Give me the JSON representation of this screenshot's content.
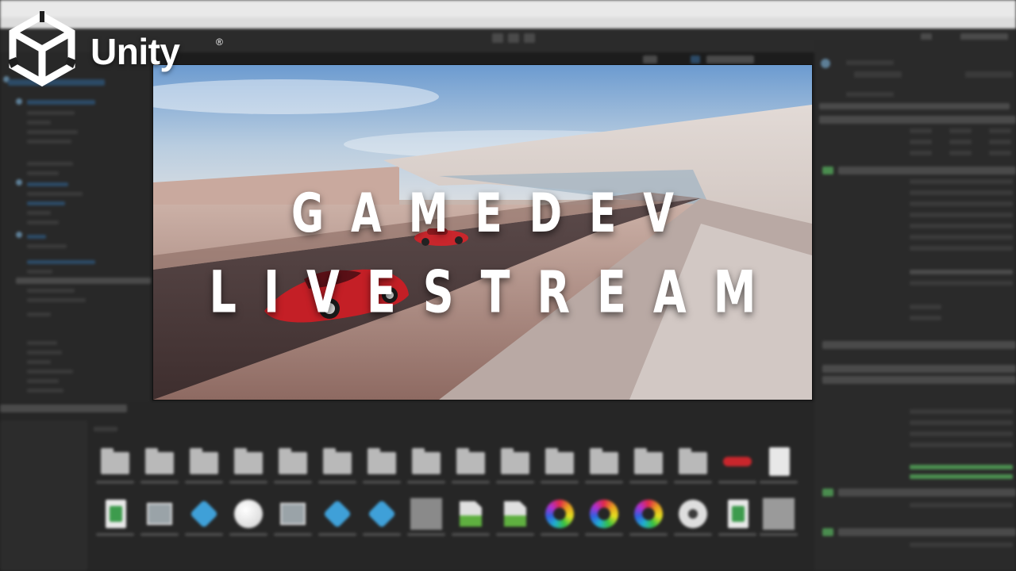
{
  "logo": {
    "wordmark": "Unity",
    "registered": "®"
  },
  "headline": {
    "line1": "GAMEDEV",
    "line2": "LIVESTREAM"
  },
  "colors": {
    "editor_bg": "#1f1f1f",
    "panel_bg": "#282828",
    "selection": "#2c4a66",
    "car_red": "#c8262c",
    "text_white": "#ffffff"
  },
  "project_assets": {
    "row1": [
      "folder",
      "folder",
      "folder",
      "folder",
      "folder",
      "folder",
      "folder",
      "folder",
      "folder",
      "folder",
      "folder",
      "folder",
      "folder",
      "folder",
      "car-thumbnail",
      "document"
    ],
    "row2": [
      "script",
      "image",
      "prefab-variant",
      "material-sphere",
      "image",
      "prefab",
      "prefab",
      "texture",
      "sprite",
      "sprite",
      "color-wheel",
      "color-wheel",
      "color-wheel",
      "film-reel",
      "script",
      "texture"
    ]
  }
}
